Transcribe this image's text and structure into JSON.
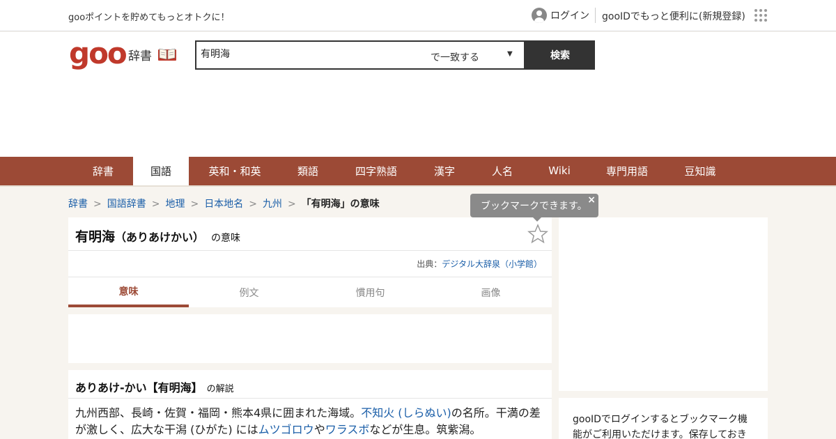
{
  "topbar": {
    "promo": "gooポイントを貯めてもっとオトクに！",
    "login": "ログイン",
    "register": "gooIDでもっと便利に(新規登録)"
  },
  "header": {
    "logo": "goo",
    "logo_sub": "辞書",
    "search_value": "有明海",
    "search_mode": "で一致する",
    "search_button": "検索"
  },
  "nav": {
    "items": [
      {
        "label": "辞書"
      },
      {
        "label": "国語"
      },
      {
        "label": "英和・和英"
      },
      {
        "label": "類語"
      },
      {
        "label": "四字熟語"
      },
      {
        "label": "漢字"
      },
      {
        "label": "人名"
      },
      {
        "label": "Wiki"
      },
      {
        "label": "専門用語"
      },
      {
        "label": "豆知識"
      }
    ]
  },
  "breadcrumb": {
    "items": [
      "辞書",
      "国語辞書",
      "地理",
      "日本地名",
      "九州"
    ],
    "current": "「有明海」の意味"
  },
  "tooltip": {
    "text": "ブックマークできます。",
    "close": "×"
  },
  "entry": {
    "title": "有明海",
    "reading": "（ありあけかい）",
    "title_suffix": "の意味",
    "source_label": "出典：",
    "source_link": "デジタル大辞泉（小学館）",
    "tabs": [
      "意味",
      "例文",
      "慣用句",
      "画像"
    ],
    "head": "ありあけ-かい【有明海】",
    "head_suffix": "の解説",
    "body_1": "九州西部、長崎・佐賀・福岡・熊本4県に囲まれた海域。",
    "link_1": "不知火 (しらぬい)",
    "body_2": "の名所。干満の差が激しく、広大な干潟 (ひがた) には",
    "link_2": "ムツゴロウ",
    "body_3": "や",
    "link_3": "ワラスボ",
    "body_4": "などが生息。筑紫潟。"
  },
  "side": {
    "text": "gooIDでログインするとブックマーク機能がご利用いただけます。保存しておき"
  }
}
